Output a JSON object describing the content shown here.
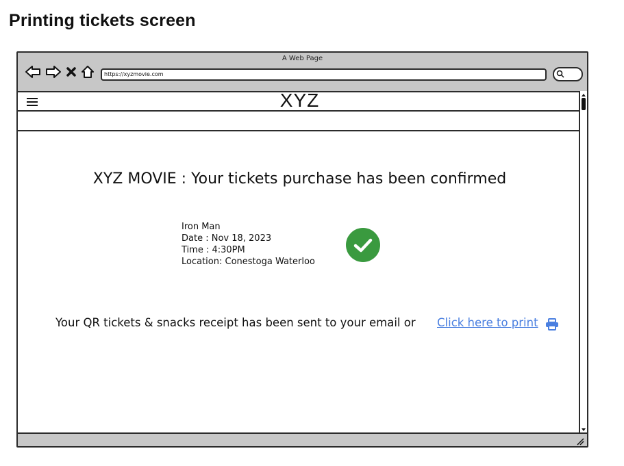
{
  "page_heading": "Printing tickets screen",
  "browser": {
    "window_title": "A Web Page",
    "url": "https://xyzmovie.com"
  },
  "app": {
    "logo": "XYZ"
  },
  "confirmation": {
    "title": "XYZ MOVIE : Your tickets purchase has been confirmed",
    "movie": "Iron Man",
    "date": "Date : Nov 18, 2023",
    "time": "Time : 4:30PM",
    "location": "Location: Conestoga Waterloo",
    "success_color": "#3a9a3f"
  },
  "receipt": {
    "message": "Your QR tickets & snacks receipt has been sent to your email or",
    "print_link": "Click here to print",
    "link_color": "#4a7fe0"
  },
  "icons": [
    "back-arrow-icon",
    "forward-arrow-icon",
    "close-icon",
    "home-icon",
    "search-icon",
    "hamburger-menu-icon",
    "checkmark-circle-icon",
    "printer-icon"
  ]
}
